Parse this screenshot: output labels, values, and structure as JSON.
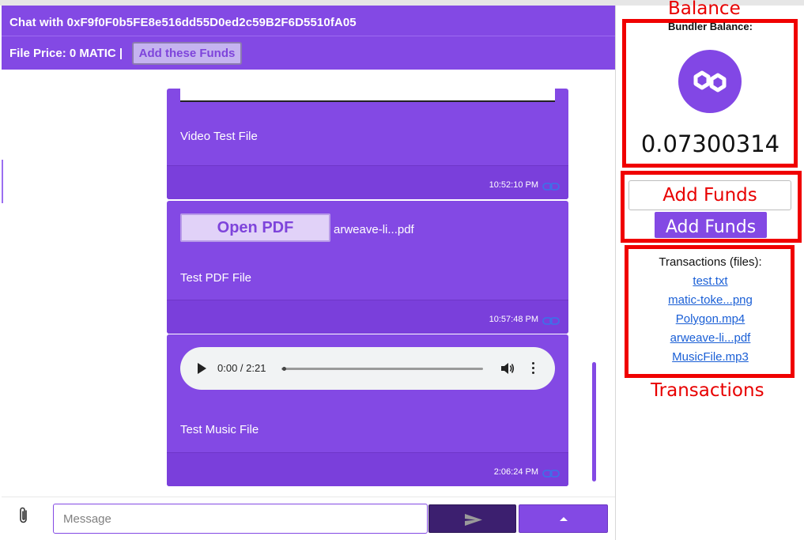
{
  "chat": {
    "title": "Chat with 0xF9f0F0b5FE8e516dd55D0ed2c59B2F6D5510fA05",
    "price_label": "File Price: 0 MATIC |",
    "add_these_funds_label": "Add these Funds"
  },
  "messages": [
    {
      "type": "video",
      "caption": "Video Test File",
      "time": "10:52:10 PM"
    },
    {
      "type": "pdf",
      "button_label": "Open PDF",
      "file_name": "arweave-li...pdf",
      "caption": "Test PDF File",
      "time": "10:57:48 PM"
    },
    {
      "type": "audio",
      "player_time": "0:00 / 2:21",
      "caption": "Test Music File",
      "time": "2:06:24 PM"
    }
  ],
  "composer": {
    "placeholder": "Message",
    "value": ""
  },
  "sidebar": {
    "balance_annotation": "Balance",
    "balance_title": "Bundler Balance:",
    "balance_value": "0.07300314",
    "add_funds_placeholder": "Add Funds",
    "add_funds_button": "Add Funds",
    "transactions_title": "Transactions (files):",
    "transactions": [
      "test.txt",
      "matic-toke...png",
      "Polygon.mp4",
      "arweave-li...pdf",
      "MusicFile.mp3"
    ],
    "transactions_annotation": "Transactions"
  },
  "colors": {
    "accent": "#8349e4",
    "accent_dark": "#3c1f6f",
    "annotation": "#f00000",
    "link": "#1a5fd6"
  },
  "icons": [
    "link-icon",
    "play-icon",
    "volume-icon",
    "more-vert-icon",
    "paperclip-icon",
    "send-icon",
    "chevron-up-icon",
    "polygon-matic-logo"
  ]
}
